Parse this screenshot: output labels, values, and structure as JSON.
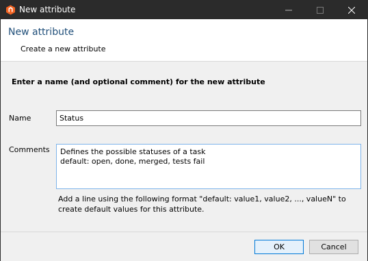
{
  "window": {
    "title": "New attribute",
    "icon": "app-logo-icon",
    "controls": [
      "minimize-icon",
      "maximize-icon",
      "close-icon"
    ],
    "title_bar_color": "#2b2b2b"
  },
  "header": {
    "title": "New attribute",
    "subtitle": "Create a new attribute",
    "title_color": "#1f4e79"
  },
  "form": {
    "instruction": "Enter a name (and optional comment) for the new attribute",
    "name_label": "Name",
    "name_value": "Status",
    "comments_label": "Comments",
    "comments_value": "Defines the possible statuses of a task\ndefault: open, done, merged, tests fail",
    "hint": "Add a line using the following format \"default: value1, value2, ..., valueN\" to create default values for this attribute."
  },
  "footer": {
    "ok_label": "OK",
    "cancel_label": "Cancel"
  }
}
